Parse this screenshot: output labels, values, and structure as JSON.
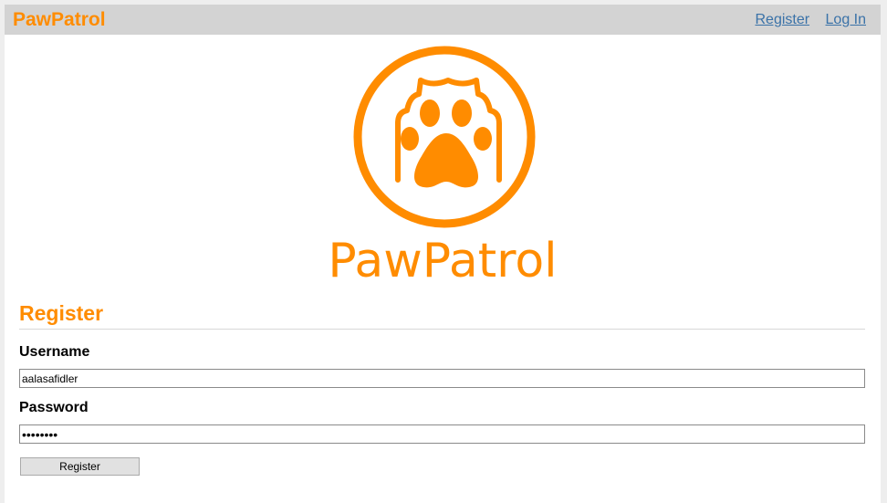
{
  "navbar": {
    "brand": "PawPatrol",
    "links": [
      {
        "label": "Register"
      },
      {
        "label": "Log In"
      }
    ]
  },
  "logo": {
    "wordmark": "PawPatrol",
    "icon": "paw-circle-icon",
    "color": "#ff8c00"
  },
  "form": {
    "title": "Register",
    "username": {
      "label": "Username",
      "value": "aalasafidler"
    },
    "password": {
      "label": "Password",
      "value": "••••••••"
    },
    "submit_label": "Register"
  },
  "colors": {
    "accent": "#ff8c00",
    "navbar_bg": "#d3d3d3",
    "link": "#3a72a8"
  }
}
